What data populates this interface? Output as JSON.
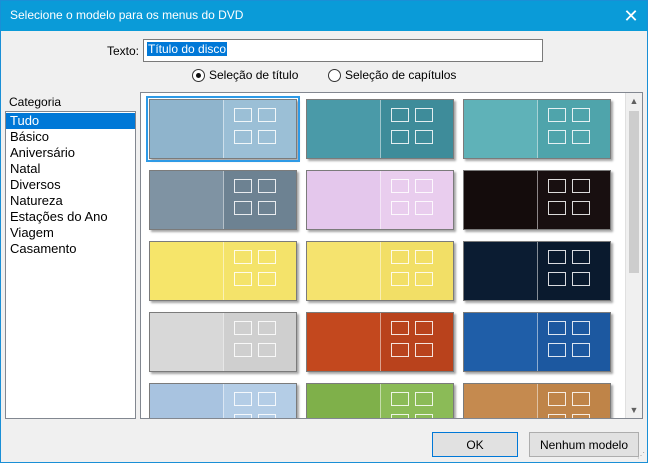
{
  "window": {
    "title": "Selecione o modelo para os menus do DVD",
    "close_icon": "close-icon"
  },
  "texto": {
    "label": "Texto:",
    "value": "Título do disco"
  },
  "radios": [
    {
      "label": "Seleção de título",
      "selected": true
    },
    {
      "label": "Seleção de capítulos",
      "selected": false
    }
  ],
  "categoria": {
    "label": "Categoria",
    "items": [
      "Tudo",
      "Básico",
      "Aniversário",
      "Natal",
      "Diversos",
      "Natureza",
      "Estações do Ano",
      "Viagem",
      "Casamento"
    ],
    "selected_index": 0
  },
  "thumbnails": [
    {
      "theme": "blue-waves",
      "left_color": "#8fb4cc",
      "right_color": "#9bbfd6",
      "selected": true
    },
    {
      "theme": "teal-lines",
      "left_color": "#4a9aa8",
      "right_color": "#3e8c9a",
      "selected": false
    },
    {
      "theme": "aqua-ovals",
      "left_color": "#5fb2b8",
      "right_color": "#4fa4ab",
      "selected": false
    },
    {
      "theme": "gray-blue",
      "left_color": "#7f93a3",
      "right_color": "#6d8292",
      "selected": false
    },
    {
      "theme": "party-lilac",
      "left_color": "#e4c7ec",
      "right_color": "#e9cdee",
      "selected": false
    },
    {
      "theme": "birthday-dark",
      "left_color": "#140c0c",
      "right_color": "#180f10",
      "selected": false
    },
    {
      "theme": "christmas-yellow",
      "left_color": "#f6e56a",
      "right_color": "#f4e36a",
      "selected": false
    },
    {
      "theme": "christmas-yellow-2",
      "left_color": "#f5e36e",
      "right_color": "#f2df66",
      "selected": false
    },
    {
      "theme": "night-circles",
      "left_color": "#0b1c32",
      "right_color": "#0a1a2e",
      "selected": false
    },
    {
      "theme": "penguin-gray",
      "left_color": "#d8d8d8",
      "right_color": "#cfcfcf",
      "selected": false
    },
    {
      "theme": "sunset-clouds",
      "left_color": "#c3481e",
      "right_color": "#b9421c",
      "selected": false
    },
    {
      "theme": "blue-forest",
      "left_color": "#1f5ea8",
      "right_color": "#1c58a0",
      "selected": false
    },
    {
      "theme": "winter-trees",
      "left_color": "#a8c3e0",
      "right_color": "#b4cde6",
      "selected": false
    },
    {
      "theme": "spring-trees",
      "left_color": "#7fb04a",
      "right_color": "#8bbb57",
      "selected": false
    },
    {
      "theme": "brown-paper",
      "left_color": "#c58a4f",
      "right_color": "#bf8448",
      "selected": false
    }
  ],
  "scrollbar": {
    "up_icon": "scroll-up-icon",
    "down_icon": "scroll-down-icon"
  },
  "buttons": {
    "ok": "OK",
    "none": "Nenhum modelo"
  }
}
